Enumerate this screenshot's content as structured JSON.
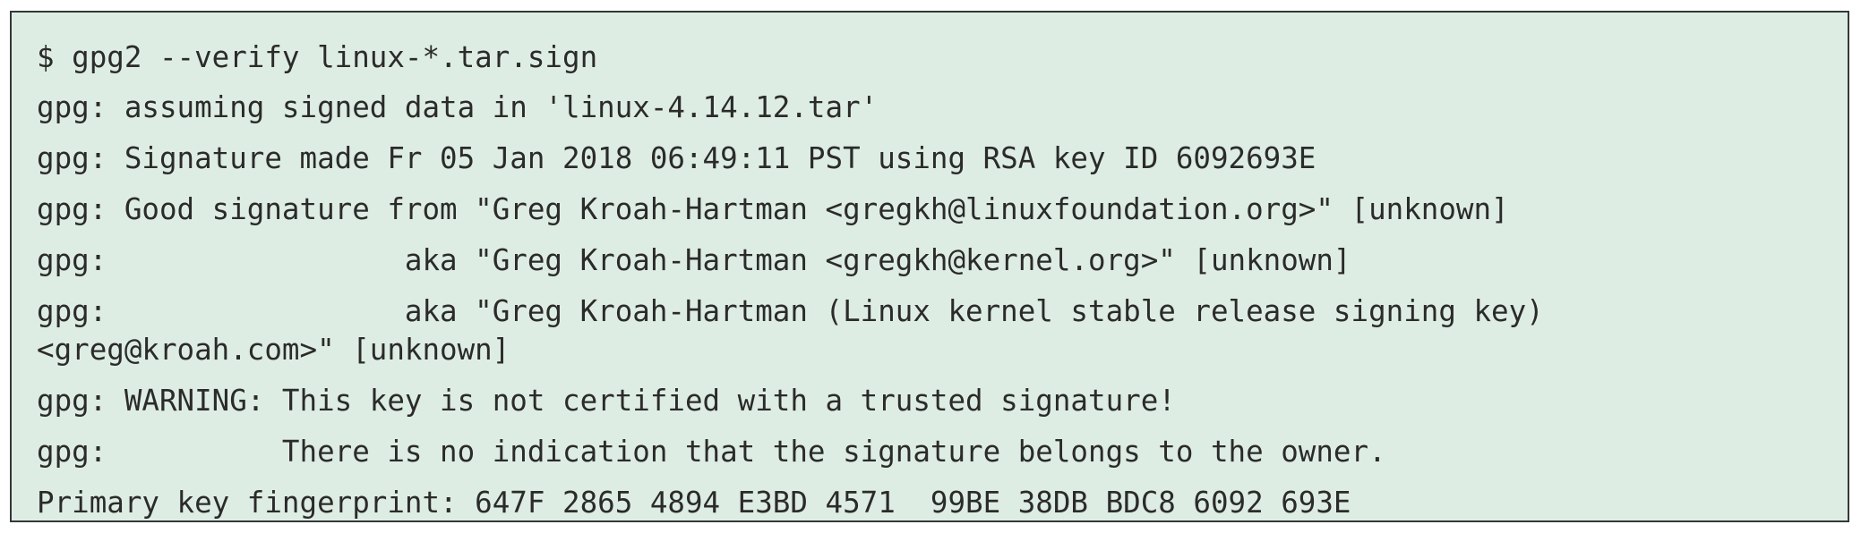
{
  "terminal": {
    "lines": [
      "$ gpg2 --verify linux-*.tar.sign",
      "gpg: assuming signed data in 'linux-4.14.12.tar'",
      "gpg: Signature made Fr 05 Jan 2018 06:49:11 PST using RSA key ID 6092693E",
      "gpg: Good signature from \"Greg Kroah-Hartman <gregkh@linuxfoundation.org>\" [unknown]",
      "gpg:                 aka \"Greg Kroah-Hartman <gregkh@kernel.org>\" [unknown]",
      "gpg:                 aka \"Greg Kroah-Hartman (Linux kernel stable release signing key)",
      "<greg@kroah.com>\" [unknown]",
      "gpg: WARNING: This key is not certified with a trusted signature!",
      "gpg:          There is no indication that the signature belongs to the owner.",
      "Primary key fingerprint: 647F 2865 4894 E3BD 4571  99BE 38DB BDC8 6092 693E"
    ]
  }
}
